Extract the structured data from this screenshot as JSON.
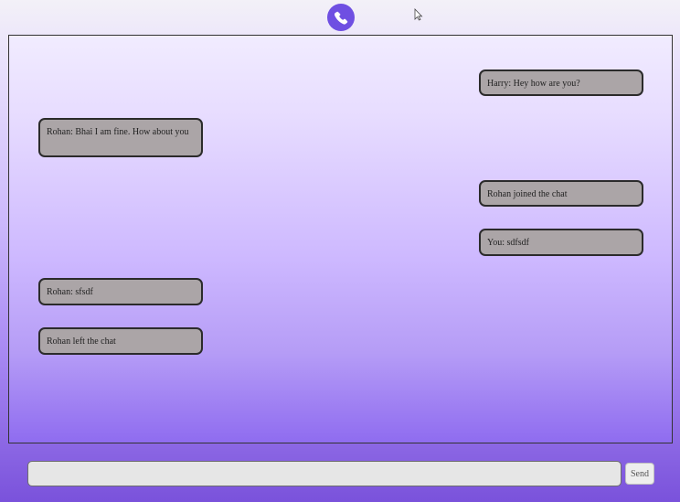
{
  "header": {
    "logo_icon": "phone-bubble-icon",
    "accent_color": "#6f4fe2"
  },
  "messages": [
    {
      "text": "Harry: Hey how are you?",
      "align": "right"
    },
    {
      "text": "Rohan: Bhai I am fine. How about you",
      "align": "left"
    },
    {
      "text": "Rohan joined the chat",
      "align": "right"
    },
    {
      "text": "You: sdfsdf",
      "align": "right"
    },
    {
      "text": "Rohan: sfsdf",
      "align": "left"
    },
    {
      "text": "Rohan left the chat",
      "align": "left"
    }
  ],
  "composer": {
    "input_value": "",
    "placeholder": "",
    "send_label": "Send"
  }
}
